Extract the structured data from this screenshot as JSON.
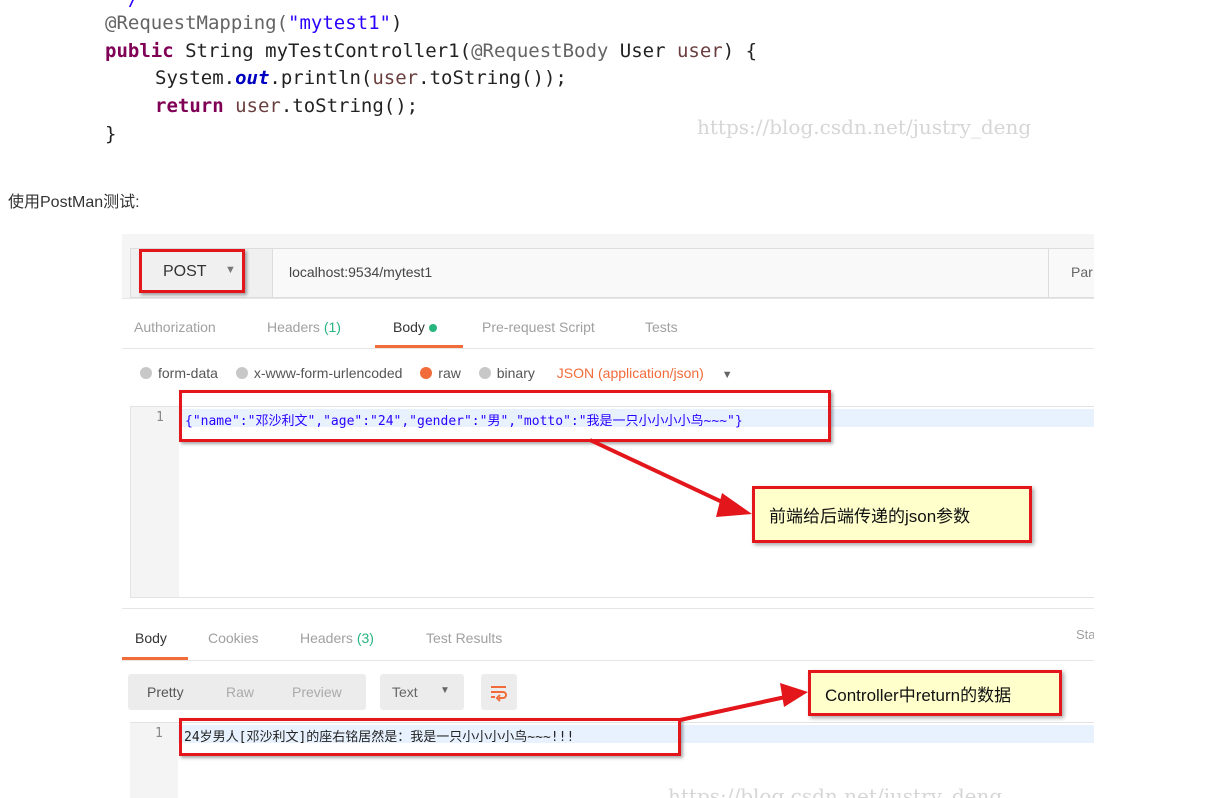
{
  "code": {
    "line1": {
      "annotation": "@RequestMapping(",
      "string": "\"mytest1\"",
      "close": ")"
    },
    "line2": {
      "kw": "public",
      "rest": " String myTestController1(",
      "annotation": "@RequestBody",
      "type": " User ",
      "var": "user",
      "end": ") {"
    },
    "line3": {
      "pre": "System.",
      "field": "out",
      "mid": ".println(",
      "var": "user",
      "end": ".toString());"
    },
    "line4": {
      "kw": "return",
      "var": " user",
      "end": ".toString();"
    },
    "line5": "}"
  },
  "watermark": "https://blog.csdn.net/justry_deng",
  "intro": "使用PostMan测试:",
  "postman": {
    "method": "POST",
    "url": "localhost:9534/mytest1",
    "params_label": "Par",
    "request_tabs": [
      {
        "label": "Authorization"
      },
      {
        "label": "Headers",
        "count": "(1)"
      },
      {
        "label": "Body",
        "active": true
      },
      {
        "label": "Pre-request Script"
      },
      {
        "label": "Tests"
      }
    ],
    "body_types": [
      "form-data",
      "x-www-form-urlencoded",
      "raw",
      "binary"
    ],
    "selected_body_type": "raw",
    "content_type": "JSON (application/json)",
    "request_line_number": "1",
    "request_body": "{\"name\":\"邓沙利文\",\"age\":\"24\",\"gender\":\"男\",\"motto\":\"我是一只小小小小鸟~~~\"}",
    "response_tabs": [
      {
        "label": "Body",
        "active": true
      },
      {
        "label": "Cookies"
      },
      {
        "label": "Headers",
        "count": "(3)"
      },
      {
        "label": "Test Results"
      }
    ],
    "status_label": "Sta",
    "view_modes": [
      "Pretty",
      "Raw",
      "Preview"
    ],
    "format": "Text",
    "response_line_number": "1",
    "response_body": "24岁男人[邓沙利文]的座右铭居然是：我是一只小小小小鸟~~~!!!",
    "accent": "#f26b3a",
    "count_color": "#26b47f"
  },
  "annotations": {
    "request_note": "前端给后端传递的json参数",
    "response_note": "Controller中return的数据"
  }
}
